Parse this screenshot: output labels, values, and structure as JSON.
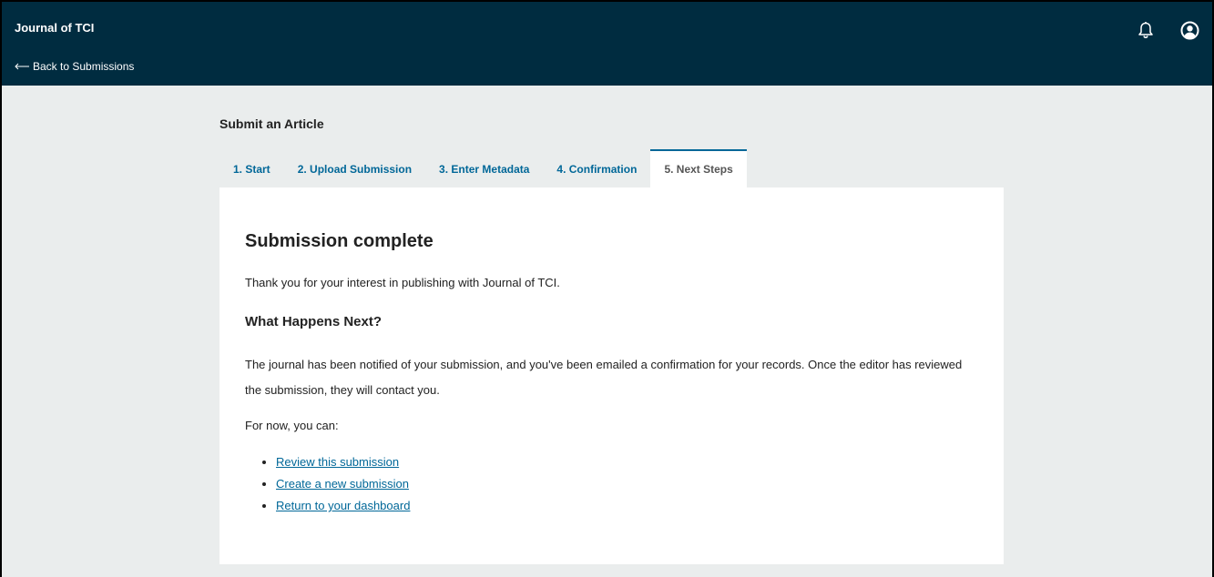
{
  "header": {
    "journal_title": "Journal of TCI",
    "back_link": "Back to Submissions",
    "back_arrow_icon": "long-arrow-left-icon",
    "notifications_icon": "bell-icon",
    "user_icon": "user-circle-icon",
    "background_color": "#002c40"
  },
  "page": {
    "heading": "Submit an Article",
    "tabs": [
      {
        "label": "1. Start",
        "active": false
      },
      {
        "label": "2. Upload Submission",
        "active": false
      },
      {
        "label": "3. Enter Metadata",
        "active": false
      },
      {
        "label": "4. Confirmation",
        "active": false
      },
      {
        "label": "5. Next Steps",
        "active": true
      }
    ]
  },
  "panel": {
    "title": "Submission complete",
    "thanks": "Thank you for your interest in publishing with Journal of TCI.",
    "next_heading": "What Happens Next?",
    "notified_text": "The journal has been notified of your submission, and you've been emailed a confirmation for your records. Once the editor has reviewed the submission, they will contact you.",
    "for_now": "For now, you can:",
    "actions": [
      {
        "label": "Review this submission"
      },
      {
        "label": "Create a new submission"
      },
      {
        "label": "Return to your dashboard"
      }
    ]
  },
  "colors": {
    "link": "#006798",
    "page_background": "#eaeded"
  }
}
